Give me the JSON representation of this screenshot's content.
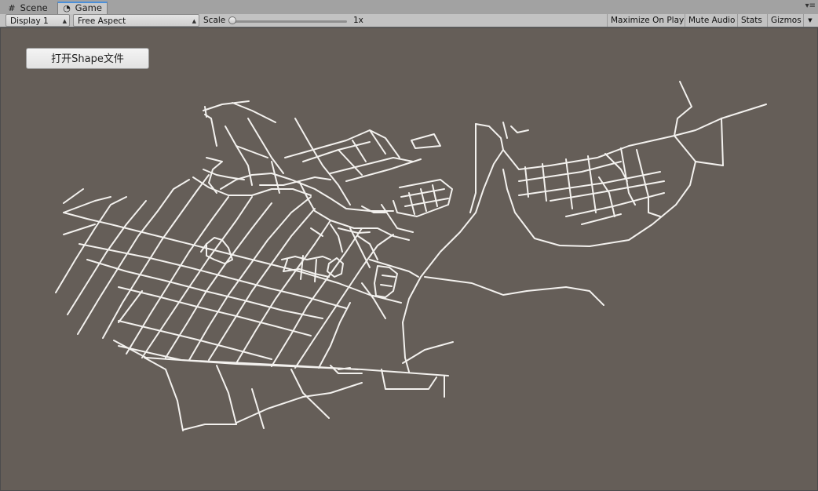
{
  "tabs": [
    {
      "label": "Scene",
      "icon": "grid-icon"
    },
    {
      "label": "Game",
      "icon": "pacman-icon"
    }
  ],
  "toolbar": {
    "display": "Display 1",
    "aspect": "Free Aspect",
    "scale_label": "Scale",
    "scale_value": "1x",
    "maximize": "Maximize On Play",
    "mute": "Mute Audio",
    "stats": "Stats",
    "gizmos": "Gizmos"
  },
  "game": {
    "open_button": "打开Shape文件",
    "background": "#655e58",
    "road_color": "#f3f1ee"
  }
}
